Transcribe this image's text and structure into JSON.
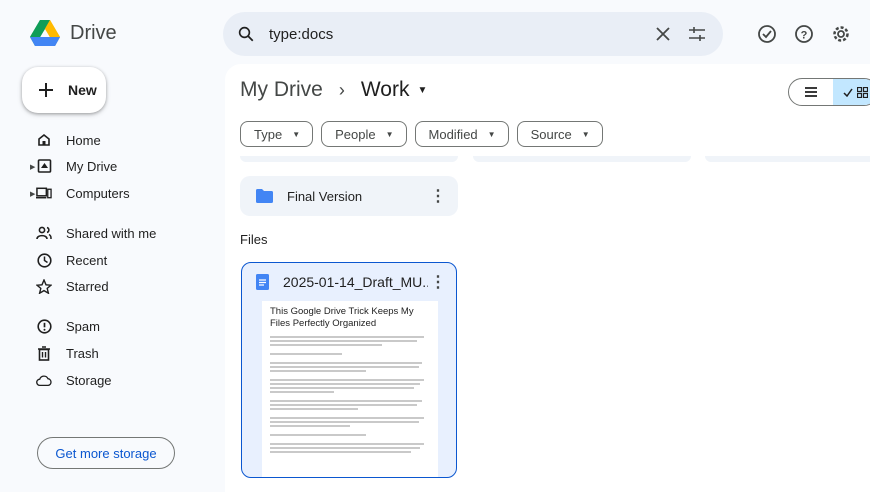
{
  "app": {
    "name": "Drive"
  },
  "search": {
    "query": "type:docs"
  },
  "sidebar": {
    "new_label": "New",
    "items": [
      {
        "label": "Home",
        "icon": "home-icon"
      },
      {
        "label": "My Drive",
        "icon": "my-drive-icon"
      },
      {
        "label": "Computers",
        "icon": "computers-icon"
      },
      {
        "label": "Shared with me",
        "icon": "shared-icon"
      },
      {
        "label": "Recent",
        "icon": "clock-icon"
      },
      {
        "label": "Starred",
        "icon": "star-icon"
      },
      {
        "label": "Spam",
        "icon": "spam-icon"
      },
      {
        "label": "Trash",
        "icon": "trash-icon"
      },
      {
        "label": "Storage",
        "icon": "cloud-icon"
      }
    ],
    "storage_button": "Get more storage"
  },
  "breadcrumb": {
    "root": "My Drive",
    "current": "Work"
  },
  "filters": [
    "Type",
    "People",
    "Modified",
    "Source"
  ],
  "folder": {
    "name": "Final Version"
  },
  "files_label": "Files",
  "file": {
    "title": "2025-01-14_Draft_MU...",
    "preview_heading": "This Google Drive Trick Keeps My Files Perfectly Organized"
  },
  "colors": {
    "accent": "#0b57d0",
    "selected": "#c2e7ff",
    "search_bg": "#e9eef6",
    "doc_blue": "#4285f4"
  }
}
